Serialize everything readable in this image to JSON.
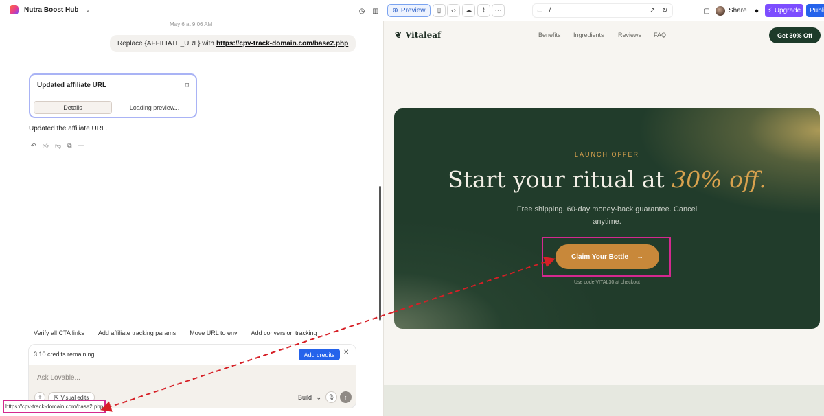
{
  "topbar": {
    "project_name": "Nutra Boost Hub",
    "preview_label": "Preview",
    "url_path": "/",
    "share_label": "Share",
    "upgrade_label": "Upgrade",
    "publish_label": "Publi"
  },
  "chat": {
    "timestamp": "May 6 at 9:06 AM",
    "user_message_prefix": "Replace {AFFILIATE_URL} with",
    "user_message_link": "https://cpv-track-domain.com/base2.php",
    "card": {
      "title": "Updated affiliate URL",
      "details_label": "Details",
      "loading_label": "Loading preview..."
    },
    "reply": "Updated the affiliate URL.",
    "suggestions": [
      "Verify all CTA links",
      "Add affiliate tracking params",
      "Move URL to env",
      "Add conversion tracking"
    ],
    "credits_text": "3.10 credits remaining",
    "add_credits_label": "Add credits",
    "composer_placeholder": "Ask Lovable...",
    "visual_edits_label": "Visual edits",
    "build_label": "Build"
  },
  "status_bar_url": "https://cpv-track-domain.com/base2.php",
  "site": {
    "logo": "Vitaleaf",
    "nav_links": [
      "Benefits",
      "Ingredients",
      "Reviews",
      "FAQ"
    ],
    "nav_cta": "Get 30% Off",
    "hero": {
      "eyebrow": "LAUNCH OFFER",
      "headline_main": "Start your ritual at",
      "headline_accent": "30% off.",
      "subtext": "Free shipping. 60-day money-back guarantee. Cancel anytime.",
      "cta_label": "Claim Your Bottle",
      "code_note": "Use code VITAL30 at checkout"
    }
  },
  "colors": {
    "hero_bg": "#213c2b",
    "accent_gold": "#d9a24e",
    "cta_orange": "#c8883a",
    "annotation_magenta": "#d4298f",
    "annotation_red": "#d61f26",
    "primary_blue": "#2563eb",
    "upgrade_purple": "#7c4dff"
  }
}
